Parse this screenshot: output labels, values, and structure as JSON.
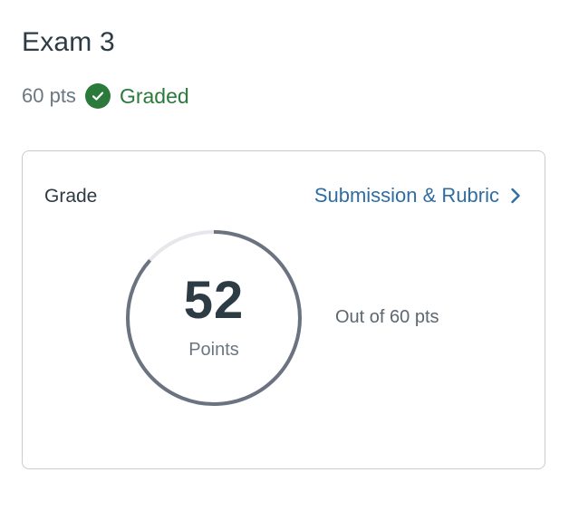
{
  "assignment": {
    "title": "Exam 3",
    "points": "60 pts",
    "status_label": "Graded",
    "status_icon": "check-circle-icon"
  },
  "grade_card": {
    "label": "Grade",
    "link_label": "Submission & Rubric",
    "link_icon": "chevron-right-icon",
    "score": "52",
    "score_unit": "Points",
    "out_of": "Out of 60 pts",
    "progress": {
      "earned": 52,
      "possible": 60
    }
  },
  "colors": {
    "text": "#2d3b45",
    "muted": "#6b7780",
    "success": "#2b7a3b",
    "link": "#2e6da4",
    "ring": "#6b7280",
    "ring_track": "#e5e7eb"
  }
}
